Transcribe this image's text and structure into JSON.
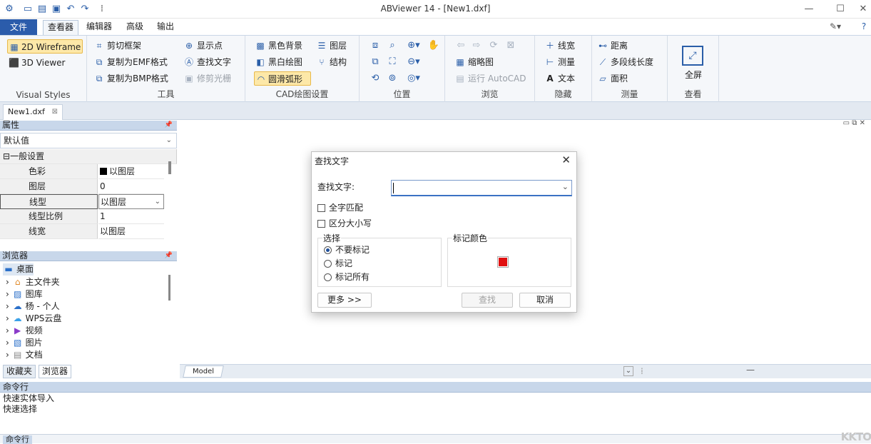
{
  "window": {
    "title": "ABViewer 14 - [New1.dxf]",
    "controls": {
      "minimize": "—",
      "maximize": "☐",
      "close": "✕"
    }
  },
  "menu": {
    "file": "文件",
    "tabs": [
      "查看器",
      "编辑器",
      "高级",
      "输出"
    ]
  },
  "ribbon": {
    "visual_styles": {
      "label": "Visual Styles",
      "items": [
        "2D Wireframe",
        "3D Viewer"
      ]
    },
    "tools": {
      "label": "工具",
      "items": [
        "剪切框架",
        "复制为EMF格式",
        "复制为BMP格式",
        "显示点",
        "查找文字",
        "修剪光栅"
      ]
    },
    "cad_settings": {
      "label": "CAD绘图设置",
      "items": [
        "黑色背景",
        "黑白绘图",
        "圆滑弧形",
        "图层",
        "结构"
      ]
    },
    "position": {
      "label": "位置"
    },
    "browse": {
      "label": "浏览",
      "items": [
        "缩略图",
        "运行 AutoCAD"
      ]
    },
    "hide": {
      "label": "隐藏",
      "items": [
        "线宽",
        "测量",
        "文本"
      ]
    },
    "measure": {
      "label": "测量",
      "items": [
        "距离",
        "多段线长度",
        "面积"
      ]
    },
    "view": {
      "label": "查看",
      "items": [
        "全屏"
      ]
    }
  },
  "doc_tab": {
    "name": "New1.dxf"
  },
  "properties": {
    "header": "属性",
    "selected": "默认值",
    "group": "一般设置",
    "rows": [
      {
        "key": "色彩",
        "value": "以图层"
      },
      {
        "key": "图层",
        "value": "0"
      },
      {
        "key": "线型",
        "value": "以图层"
      },
      {
        "key": "线型比例",
        "value": "1"
      },
      {
        "key": "线宽",
        "value": "以图层"
      }
    ]
  },
  "browser": {
    "header": "浏览器",
    "items": [
      "桌面",
      "主文件夹",
      "图库",
      "杨 - 个人",
      "WPS云盘",
      "视频",
      "图片",
      "文档"
    ],
    "tabs": [
      "收藏夹",
      "浏览器"
    ]
  },
  "model_tab": "Model",
  "command": {
    "header": "命令行",
    "log": [
      "快速实体导入",
      "快速选择"
    ],
    "input_label": "命令行"
  },
  "dialog": {
    "title": "查找文字",
    "find_label": "查找文字:",
    "find_value": "",
    "whole_word": "全字匹配",
    "match_case": "区分大小写",
    "selection": {
      "legend": "选择",
      "options": [
        "不要标记",
        "标记",
        "标记所有"
      ],
      "selected": 0
    },
    "mark_color": {
      "legend": "标记颜色",
      "color": "#e01010"
    },
    "buttons": {
      "more": "更多 >>",
      "find": "查找",
      "cancel": "取消"
    }
  },
  "watermark": "KKTO"
}
